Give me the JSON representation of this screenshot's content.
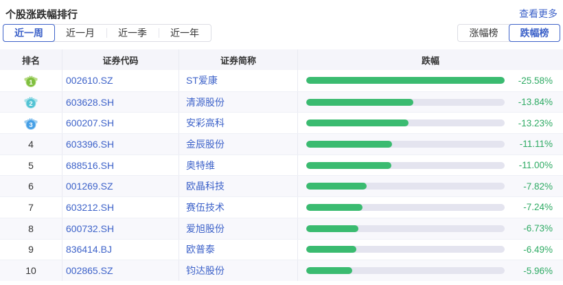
{
  "panel": {
    "title": "个股涨跌幅排行",
    "more_link": "查看更多"
  },
  "period_tabs": [
    {
      "label": "近一周",
      "active": true
    },
    {
      "label": "近一月",
      "active": false
    },
    {
      "label": "近一季",
      "active": false
    },
    {
      "label": "近一年",
      "active": false
    }
  ],
  "board_tabs": [
    {
      "label": "涨幅榜",
      "active": false
    },
    {
      "label": "跌幅榜",
      "active": true
    }
  ],
  "table": {
    "columns": [
      "排名",
      "证券代码",
      "证券简称",
      "跌幅"
    ],
    "max_abs_change_pct": 25.58,
    "rows": [
      {
        "rank": 1,
        "code": "002610.SZ",
        "name": "ST爱康",
        "change": "-25.58%",
        "value": 25.58
      },
      {
        "rank": 2,
        "code": "603628.SH",
        "name": "清源股份",
        "change": "-13.84%",
        "value": 13.84
      },
      {
        "rank": 3,
        "code": "600207.SH",
        "name": "安彩高科",
        "change": "-13.23%",
        "value": 13.23
      },
      {
        "rank": 4,
        "code": "603396.SH",
        "name": "金辰股份",
        "change": "-11.11%",
        "value": 11.11
      },
      {
        "rank": 5,
        "code": "688516.SH",
        "name": "奥特维",
        "change": "-11.00%",
        "value": 11.0
      },
      {
        "rank": 6,
        "code": "001269.SZ",
        "name": "欧晶科技",
        "change": "-7.82%",
        "value": 7.82
      },
      {
        "rank": 7,
        "code": "603212.SH",
        "name": "赛伍技术",
        "change": "-7.24%",
        "value": 7.24
      },
      {
        "rank": 8,
        "code": "600732.SH",
        "name": "爱旭股份",
        "change": "-6.73%",
        "value": 6.73
      },
      {
        "rank": 9,
        "code": "836414.BJ",
        "name": "欧普泰",
        "change": "-6.49%",
        "value": 6.49
      },
      {
        "rank": 10,
        "code": "002865.SZ",
        "name": "钧达股份",
        "change": "-5.96%",
        "value": 5.96
      }
    ]
  },
  "colors": {
    "accent_blue": "#3d62c9",
    "bar_green": "#3abb70",
    "pct_green": "#2daa63",
    "bar_track": "#e4e4ef",
    "medals": [
      {
        "main": "#7fbf3f",
        "light": "#b9dc85"
      },
      {
        "main": "#53c3d4",
        "light": "#a6e2ea"
      },
      {
        "main": "#459fe6",
        "light": "#9ccdf2"
      }
    ]
  }
}
